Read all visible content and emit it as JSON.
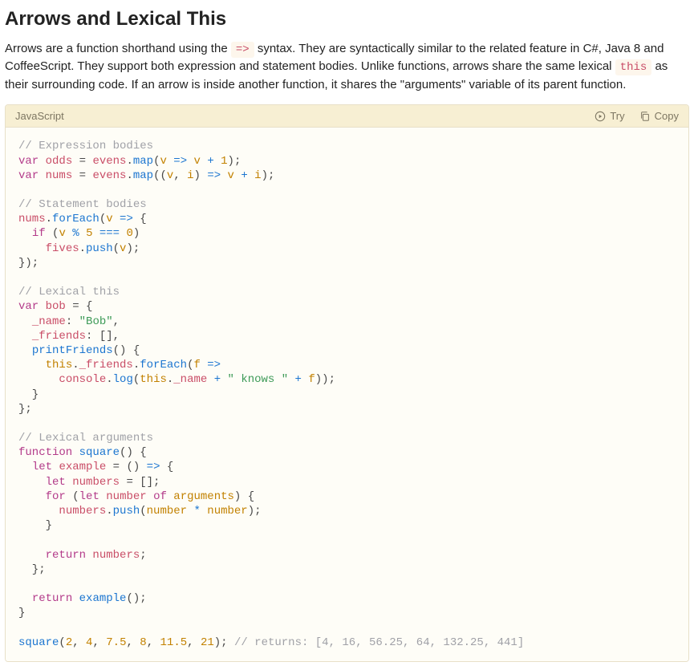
{
  "heading": "Arrows and Lexical This",
  "desc": {
    "t1": "Arrows are a function shorthand using the ",
    "inline1": "=>",
    "t2": " syntax. They are syntactically similar to the related feature in C#, Java 8 and CoffeeScript. They support both expression and statement bodies. Unlike functions, arrows share the same lexical ",
    "inline2": "this",
    "t3": " as their surrounding code. If an arrow is inside another function, it shares the \"arguments\" variable of its parent function."
  },
  "codeHeader": {
    "lang": "JavaScript",
    "try": "Try",
    "copy": "Copy"
  },
  "code": {
    "c1": "// Expression bodies",
    "l2": {
      "kw": "var",
      "id": "odds",
      "eq": " = ",
      "obj": "evens",
      "dot": ".",
      "m": "map",
      "op1": "(",
      "p": "v",
      "arr": " => ",
      "p2": "v",
      "plus": " + ",
      "n": "1",
      "end": ");"
    },
    "l3": {
      "kw": "var",
      "id": "nums",
      "eq": " = ",
      "obj": "evens",
      "dot": ".",
      "m": "map",
      "op1": "((",
      "p1": "v",
      "comma": ", ",
      "p2": "i",
      "cp": ")",
      "arr": " => ",
      "p3": "v",
      "plus": " + ",
      "p4": "i",
      "end": ");"
    },
    "c2": "// Statement bodies",
    "l5": {
      "obj": "nums",
      "dot": ".",
      "m": "forEach",
      "op": "(",
      "p": "v",
      "arr": " => ",
      "br": "{"
    },
    "l6": {
      "ind": "  ",
      "kw": "if",
      "op": " (",
      "p": "v",
      "mod": " % ",
      "n1": "5",
      "eq": " === ",
      "n2": "0",
      "cp": ")"
    },
    "l7": {
      "ind": "    ",
      "obj": "fives",
      "dot": ".",
      "m": "push",
      "op": "(",
      "p": "v",
      "end": ");"
    },
    "l8": "});",
    "c3": "// Lexical this",
    "l10": {
      "kw": "var",
      "id": "bob",
      "eq": " = {"
    },
    "l11": {
      "ind": "  ",
      "key": "_name",
      "col": ": ",
      "str": "\"Bob\"",
      "end": ","
    },
    "l12": {
      "ind": "  ",
      "key": "_friends",
      "col": ": [],",
      "end": ""
    },
    "l13": {
      "ind": "  ",
      "m": "printFriends",
      "par": "() {"
    },
    "l14": {
      "ind": "    ",
      "this": "this",
      "dot1": ".",
      "prop": "_friends",
      "dot2": ".",
      "m": "forEach",
      "op": "(",
      "p": "f",
      "arr": " =>"
    },
    "l15": {
      "ind": "      ",
      "obj": "console",
      "dot": ".",
      "m": "log",
      "op": "(",
      "this": "this",
      "dot2": ".",
      "prop": "_name",
      "plus1": " + ",
      "str": "\" knows \"",
      "plus2": " + ",
      "p": "f",
      "end": "));"
    },
    "l16": "  }",
    "l17": "};",
    "c4": "// Lexical arguments",
    "l19": {
      "kw": "function",
      "id": "square",
      "par": "() {"
    },
    "l20": {
      "ind": "  ",
      "kw": "let",
      "id": "example",
      "eq": " = () ",
      "arr": "=>",
      "br": " {"
    },
    "l21": {
      "ind": "    ",
      "kw": "let",
      "id": "numbers",
      "eq": " = [];"
    },
    "l22": {
      "ind": "    ",
      "kw": "for",
      "op": " (",
      "kw2": "let",
      "id": "number",
      "of": " of ",
      "arg": "arguments",
      "cp": ") {"
    },
    "l23": {
      "ind": "      ",
      "obj": "numbers",
      "dot": ".",
      "m": "push",
      "op": "(",
      "p1": "number",
      "mul": " * ",
      "p2": "number",
      "end": ");"
    },
    "l24": "    }",
    "l26": {
      "ind": "    ",
      "kw": "return",
      "id": " numbers",
      "end": ";"
    },
    "l27": "  };",
    "l29": {
      "ind": "  ",
      "kw": "return",
      "sp": " ",
      "m": "example",
      "end": "();"
    },
    "l30": "}",
    "l32": {
      "m": "square",
      "op": "(",
      "n1": "2",
      "c1": ", ",
      "n2": "4",
      "c2": ", ",
      "n3": "7.5",
      "c3": ", ",
      "n4": "8",
      "c4": ", ",
      "n5": "11.5",
      "c5": ", ",
      "n6": "21",
      "cp": "); ",
      "cmt": "// returns: [4, 16, 56.25, 64, 132.25, 441]"
    }
  }
}
